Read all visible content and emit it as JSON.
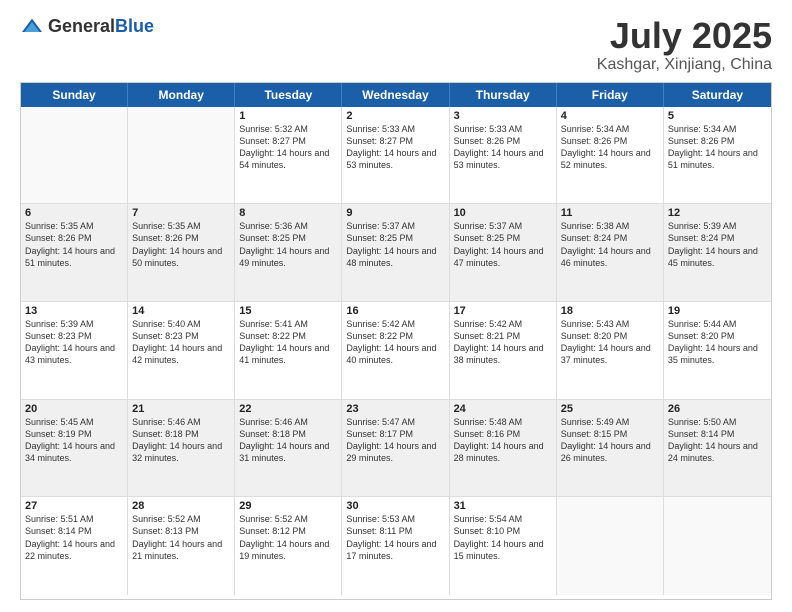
{
  "header": {
    "logo_general": "General",
    "logo_blue": "Blue",
    "month": "July 2025",
    "location": "Kashgar, Xinjiang, China"
  },
  "weekdays": [
    "Sunday",
    "Monday",
    "Tuesday",
    "Wednesday",
    "Thursday",
    "Friday",
    "Saturday"
  ],
  "rows": [
    [
      {
        "day": "",
        "empty": true
      },
      {
        "day": "",
        "empty": true
      },
      {
        "day": "1",
        "sunrise": "Sunrise: 5:32 AM",
        "sunset": "Sunset: 8:27 PM",
        "daylight": "Daylight: 14 hours and 54 minutes."
      },
      {
        "day": "2",
        "sunrise": "Sunrise: 5:33 AM",
        "sunset": "Sunset: 8:27 PM",
        "daylight": "Daylight: 14 hours and 53 minutes."
      },
      {
        "day": "3",
        "sunrise": "Sunrise: 5:33 AM",
        "sunset": "Sunset: 8:26 PM",
        "daylight": "Daylight: 14 hours and 53 minutes."
      },
      {
        "day": "4",
        "sunrise": "Sunrise: 5:34 AM",
        "sunset": "Sunset: 8:26 PM",
        "daylight": "Daylight: 14 hours and 52 minutes."
      },
      {
        "day": "5",
        "sunrise": "Sunrise: 5:34 AM",
        "sunset": "Sunset: 8:26 PM",
        "daylight": "Daylight: 14 hours and 51 minutes."
      }
    ],
    [
      {
        "day": "6",
        "sunrise": "Sunrise: 5:35 AM",
        "sunset": "Sunset: 8:26 PM",
        "daylight": "Daylight: 14 hours and 51 minutes."
      },
      {
        "day": "7",
        "sunrise": "Sunrise: 5:35 AM",
        "sunset": "Sunset: 8:26 PM",
        "daylight": "Daylight: 14 hours and 50 minutes."
      },
      {
        "day": "8",
        "sunrise": "Sunrise: 5:36 AM",
        "sunset": "Sunset: 8:25 PM",
        "daylight": "Daylight: 14 hours and 49 minutes."
      },
      {
        "day": "9",
        "sunrise": "Sunrise: 5:37 AM",
        "sunset": "Sunset: 8:25 PM",
        "daylight": "Daylight: 14 hours and 48 minutes."
      },
      {
        "day": "10",
        "sunrise": "Sunrise: 5:37 AM",
        "sunset": "Sunset: 8:25 PM",
        "daylight": "Daylight: 14 hours and 47 minutes."
      },
      {
        "day": "11",
        "sunrise": "Sunrise: 5:38 AM",
        "sunset": "Sunset: 8:24 PM",
        "daylight": "Daylight: 14 hours and 46 minutes."
      },
      {
        "day": "12",
        "sunrise": "Sunrise: 5:39 AM",
        "sunset": "Sunset: 8:24 PM",
        "daylight": "Daylight: 14 hours and 45 minutes."
      }
    ],
    [
      {
        "day": "13",
        "sunrise": "Sunrise: 5:39 AM",
        "sunset": "Sunset: 8:23 PM",
        "daylight": "Daylight: 14 hours and 43 minutes."
      },
      {
        "day": "14",
        "sunrise": "Sunrise: 5:40 AM",
        "sunset": "Sunset: 8:23 PM",
        "daylight": "Daylight: 14 hours and 42 minutes."
      },
      {
        "day": "15",
        "sunrise": "Sunrise: 5:41 AM",
        "sunset": "Sunset: 8:22 PM",
        "daylight": "Daylight: 14 hours and 41 minutes."
      },
      {
        "day": "16",
        "sunrise": "Sunrise: 5:42 AM",
        "sunset": "Sunset: 8:22 PM",
        "daylight": "Daylight: 14 hours and 40 minutes."
      },
      {
        "day": "17",
        "sunrise": "Sunrise: 5:42 AM",
        "sunset": "Sunset: 8:21 PM",
        "daylight": "Daylight: 14 hours and 38 minutes."
      },
      {
        "day": "18",
        "sunrise": "Sunrise: 5:43 AM",
        "sunset": "Sunset: 8:20 PM",
        "daylight": "Daylight: 14 hours and 37 minutes."
      },
      {
        "day": "19",
        "sunrise": "Sunrise: 5:44 AM",
        "sunset": "Sunset: 8:20 PM",
        "daylight": "Daylight: 14 hours and 35 minutes."
      }
    ],
    [
      {
        "day": "20",
        "sunrise": "Sunrise: 5:45 AM",
        "sunset": "Sunset: 8:19 PM",
        "daylight": "Daylight: 14 hours and 34 minutes."
      },
      {
        "day": "21",
        "sunrise": "Sunrise: 5:46 AM",
        "sunset": "Sunset: 8:18 PM",
        "daylight": "Daylight: 14 hours and 32 minutes."
      },
      {
        "day": "22",
        "sunrise": "Sunrise: 5:46 AM",
        "sunset": "Sunset: 8:18 PM",
        "daylight": "Daylight: 14 hours and 31 minutes."
      },
      {
        "day": "23",
        "sunrise": "Sunrise: 5:47 AM",
        "sunset": "Sunset: 8:17 PM",
        "daylight": "Daylight: 14 hours and 29 minutes."
      },
      {
        "day": "24",
        "sunrise": "Sunrise: 5:48 AM",
        "sunset": "Sunset: 8:16 PM",
        "daylight": "Daylight: 14 hours and 28 minutes."
      },
      {
        "day": "25",
        "sunrise": "Sunrise: 5:49 AM",
        "sunset": "Sunset: 8:15 PM",
        "daylight": "Daylight: 14 hours and 26 minutes."
      },
      {
        "day": "26",
        "sunrise": "Sunrise: 5:50 AM",
        "sunset": "Sunset: 8:14 PM",
        "daylight": "Daylight: 14 hours and 24 minutes."
      }
    ],
    [
      {
        "day": "27",
        "sunrise": "Sunrise: 5:51 AM",
        "sunset": "Sunset: 8:14 PM",
        "daylight": "Daylight: 14 hours and 22 minutes."
      },
      {
        "day": "28",
        "sunrise": "Sunrise: 5:52 AM",
        "sunset": "Sunset: 8:13 PM",
        "daylight": "Daylight: 14 hours and 21 minutes."
      },
      {
        "day": "29",
        "sunrise": "Sunrise: 5:52 AM",
        "sunset": "Sunset: 8:12 PM",
        "daylight": "Daylight: 14 hours and 19 minutes."
      },
      {
        "day": "30",
        "sunrise": "Sunrise: 5:53 AM",
        "sunset": "Sunset: 8:11 PM",
        "daylight": "Daylight: 14 hours and 17 minutes."
      },
      {
        "day": "31",
        "sunrise": "Sunrise: 5:54 AM",
        "sunset": "Sunset: 8:10 PM",
        "daylight": "Daylight: 14 hours and 15 minutes."
      },
      {
        "day": "",
        "empty": true
      },
      {
        "day": "",
        "empty": true
      }
    ]
  ]
}
